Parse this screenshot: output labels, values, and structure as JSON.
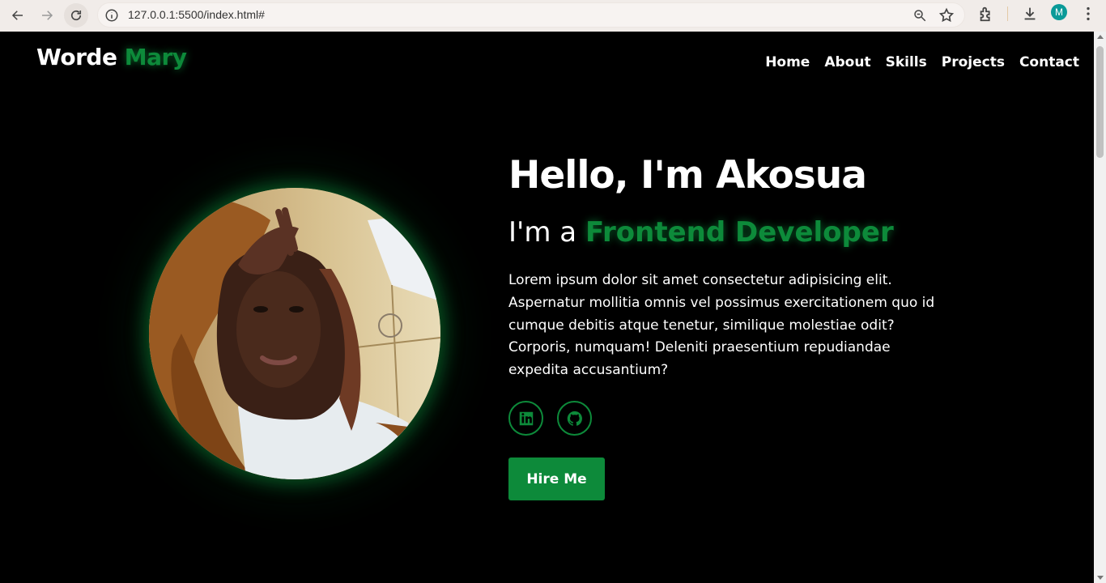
{
  "browser": {
    "url": "127.0.0.1:5500/index.html#",
    "profile_initial": "M"
  },
  "header": {
    "logo_first": "Worde",
    "logo_second": "Mary",
    "nav": [
      "Home",
      "About",
      "Skills",
      "Projects",
      "Contact"
    ]
  },
  "hero": {
    "greeting": "Hello, I'm Akosua",
    "role_prefix": "I'm a",
    "role": "Frontend Developer",
    "bio": "Lorem ipsum dolor sit amet consectetur adipisicing elit. Aspernatur mollitia omnis vel possimus exercitationem quo id cumque debitis atque tenetur, similique molestiae odit? Corporis, numquam! Deleniti praesentium repudiandae expedita accusantium?",
    "hire_label": "Hire Me"
  },
  "social_icons": [
    "linkedin-icon",
    "github-icon"
  ],
  "colors": {
    "accent": "#0d8a3a",
    "background": "#000000",
    "text": "#ffffff"
  }
}
